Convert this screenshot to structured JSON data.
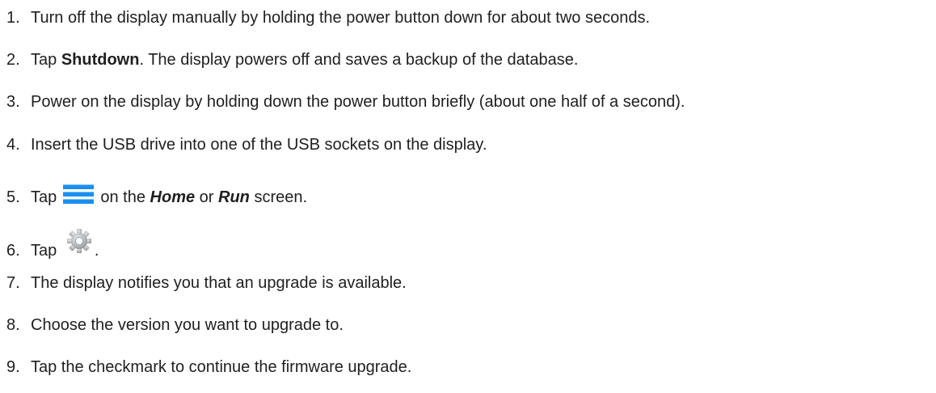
{
  "steps": [
    {
      "number": "1.",
      "text": "Turn off the display manually by holding the power button down for about two seconds."
    },
    {
      "number": "2.",
      "prefix": "Tap ",
      "bold": "Shutdown",
      "suffix": ". The display powers off and saves a backup of the database."
    },
    {
      "number": "3.",
      "text": "Power on the display by holding down the power button briefly (about one half of a second)."
    },
    {
      "number": "4.",
      "text": "Insert the USB drive into one of the USB sockets on the display."
    },
    {
      "number": "5.",
      "prefix": "Tap ",
      "icon": "menu-icon",
      "mid1": " on the ",
      "italic1": "Home",
      "mid2": " or ",
      "italic2": "Run",
      "suffix": " screen."
    },
    {
      "number": "6.",
      "prefix": "Tap ",
      "icon": "gear-icon",
      "suffix": "."
    },
    {
      "number": "7.",
      "text": "The display notifies you that an upgrade is available."
    },
    {
      "number": "8.",
      "text": "Choose the version you want to upgrade to."
    },
    {
      "number": "9.",
      "text": "Tap the checkmark to continue the firmware upgrade."
    }
  ],
  "colors": {
    "text": "#1f1f1f",
    "menu_icon": "#1a8ff0",
    "gear_icon": "#b8bcc0"
  }
}
